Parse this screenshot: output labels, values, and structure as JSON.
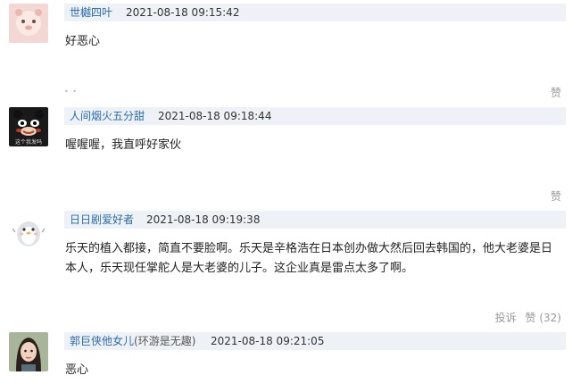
{
  "comments": [
    {
      "user": "世樾四叶",
      "user_extra": "",
      "time": "2021-08-18 09:15:42",
      "text": "好恶心",
      "report": "",
      "like": "赞",
      "like_count": ""
    },
    {
      "user": "人间烟火五分甜",
      "user_extra": "",
      "time": "2021-08-18 09:18:44",
      "text": "喔喔喔，我直呼好家伙",
      "report": "",
      "like": "赞",
      "like_count": "",
      "avatar_text": "这个我发吗"
    },
    {
      "user": "日日剧爱好者",
      "user_extra": "",
      "time": "2021-08-18 09:19:38",
      "text": "乐天的植入都接，简直不要脸啊。乐天是辛格浩在日本创办做大然后回去韩国的，他大老婆是日本人，乐天现任掌舵人是大老婆的儿子。这企业真是雷点太多了啊。",
      "report": "投诉",
      "like": "赞",
      "like_count": "(32)"
    },
    {
      "user": "郭巨侠他女儿",
      "user_extra": "(环游是无趣)",
      "time": "2021-08-18 09:21:05",
      "text": "恶心",
      "report": "",
      "like": "",
      "like_count": ""
    }
  ],
  "colors": {
    "header_bg": "#eef2f6",
    "username": "#2a6bb0",
    "action": "#999999"
  }
}
